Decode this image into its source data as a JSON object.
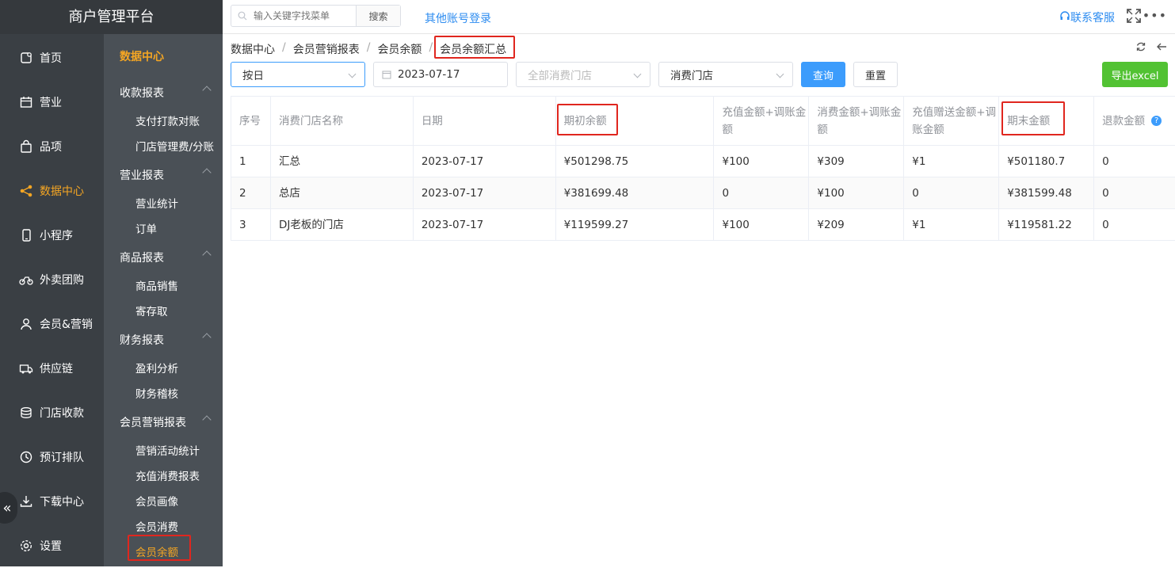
{
  "app": {
    "title": "商户管理平台"
  },
  "rail": [
    {
      "label": "首页",
      "icon": "home-icon"
    },
    {
      "label": "营业",
      "icon": "calendar-icon"
    },
    {
      "label": "品项",
      "icon": "bag-icon"
    },
    {
      "label": "数据中心",
      "icon": "share-icon",
      "active": true
    },
    {
      "label": "小程序",
      "icon": "phone-icon"
    },
    {
      "label": "外卖团购",
      "icon": "bike-icon"
    },
    {
      "label": "会员&营销",
      "icon": "user-icon"
    },
    {
      "label": "供应链",
      "icon": "truck-icon"
    },
    {
      "label": "门店收款",
      "icon": "coins-icon"
    },
    {
      "label": "预订排队",
      "icon": "clock-icon"
    },
    {
      "label": "下载中心",
      "icon": "download-icon"
    },
    {
      "label": "设置",
      "icon": "gear-icon"
    }
  ],
  "subnav": {
    "title": "数据中心",
    "groups": [
      {
        "label": "收款报表",
        "items": [
          "支付打款对账",
          "门店管理费/分账"
        ]
      },
      {
        "label": "营业报表",
        "items": [
          "营业统计",
          "订单"
        ]
      },
      {
        "label": "商品报表",
        "items": [
          "商品销售",
          "寄存取"
        ]
      },
      {
        "label": "财务报表",
        "items": [
          "盈利分析",
          "财务稽核"
        ]
      },
      {
        "label": "会员营销报表",
        "items": [
          "营销活动统计",
          "充值消费报表",
          "会员画像",
          "会员消费",
          "会员余额"
        ]
      }
    ],
    "active_item": "会员余额"
  },
  "topbar": {
    "search_placeholder": "输入关键字找菜单",
    "search_button": "搜索",
    "other_login": "其他账号登录",
    "service": "联系客服",
    "more": "•••"
  },
  "breadcrumb": [
    "数据中心",
    "会员营销报表",
    "会员余额",
    "会员余额汇总"
  ],
  "filters": {
    "period": "按日",
    "date": "2023-07-17",
    "store_placeholder": "全部消费门店",
    "store_type": "消费门店",
    "query": "查询",
    "reset": "重置",
    "export": "导出excel"
  },
  "table": {
    "headers": [
      "序号",
      "消费门店名称",
      "日期",
      "期初余额",
      "充值金额+调账金额",
      "消费金额+调账金额",
      "充值赠送金额+调账金额",
      "期末金额",
      "退款金额"
    ],
    "rows": [
      [
        "1",
        "汇总",
        "2023-07-17",
        "¥501298.75",
        "¥100",
        "¥309",
        "¥1",
        "¥501180.7",
        "0"
      ],
      [
        "2",
        "总店",
        "2023-07-17",
        "¥381699.48",
        "0",
        "¥100",
        "0",
        "¥381599.48",
        "0"
      ],
      [
        "3",
        "DJ老板的门店",
        "2023-07-17",
        "¥119599.27",
        "¥100",
        "¥209",
        "¥1",
        "¥119581.22",
        "0"
      ]
    ]
  },
  "colors": {
    "accent": "#f5a623",
    "primary": "#3c9cfc",
    "export": "#52c233",
    "highlight": "#e0261e",
    "rail": "#3a3f44",
    "subnav": "#4a5056"
  }
}
